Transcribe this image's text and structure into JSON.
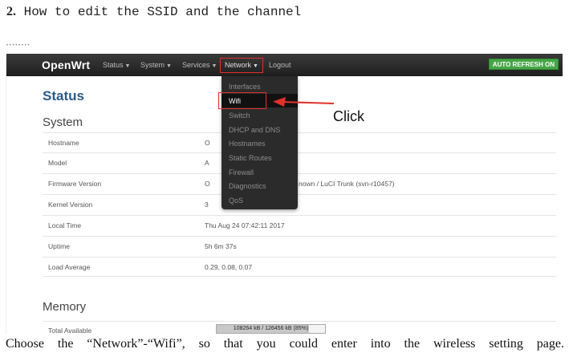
{
  "heading": {
    "number": "2.",
    "text": " How to edit the SSID and the channel"
  },
  "caption_small": "• • • • • • • •",
  "navbar": {
    "brand": "OpenWrt",
    "items": [
      "Status",
      "System",
      "Services",
      "Network",
      "Logout"
    ],
    "auto_refresh": "AUTO REFRESH ON"
  },
  "network_menu": [
    "Interfaces",
    "Wifi",
    "Switch",
    "DHCP and DNS",
    "Hostnames",
    "Static Routes",
    "Firewall",
    "Diagnostics",
    "QoS"
  ],
  "annotation": {
    "click": "Click"
  },
  "page": {
    "title": "Status",
    "system_title": "System",
    "rows": [
      {
        "key": "Hostname",
        "value": "O"
      },
      {
        "key": "Model",
        "value": "A"
      },
      {
        "key": "Firmware Version",
        "value": "O",
        "value_right": "nown / LuCI Trunk (svn-r10457)"
      },
      {
        "key": "Kernel Version",
        "value": "3"
      },
      {
        "key": "Local Time",
        "value": "Thu Aug 24 07:42:11 2017"
      },
      {
        "key": "Uptime",
        "value": "5h 6m 37s"
      },
      {
        "key": "Load Average",
        "value": "0.29, 0.08, 0.07"
      }
    ],
    "memory_title": "Memory",
    "memory_row": {
      "key": "Total Available",
      "bar_text": "108264 kB / 126456 kB (85%)",
      "fraction": 0.85
    }
  },
  "colors": {
    "title_blue": "#2a5b8a",
    "highlight_red": "#e0302a",
    "badge_green": "#46a546",
    "navbar_dark": "#2b2b2b"
  },
  "footer_text": "Choose the “Network”-“Wifi”, so that you could enter into the wireless setting page."
}
